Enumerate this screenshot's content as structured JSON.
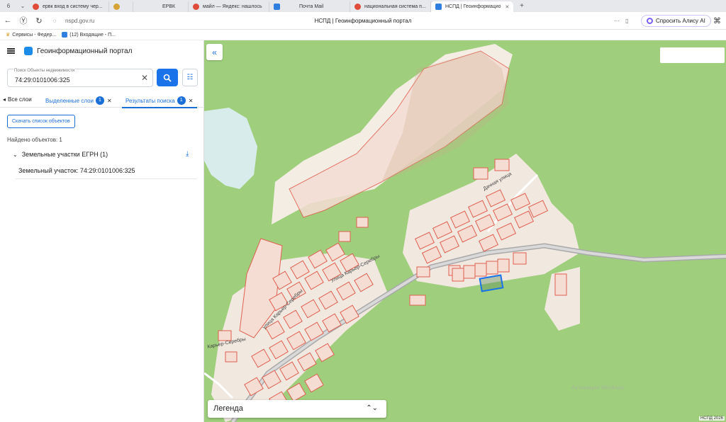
{
  "browser": {
    "tabs": [
      {
        "label": "ервк вход в систему чер...",
        "color": "#e04b3a"
      },
      {
        "label": "",
        "color": "#d6a335"
      },
      {
        "label": "ЕРВК",
        "color": ""
      },
      {
        "label": "майл — Яндекс: нашлось",
        "color": "#e04b3a"
      },
      {
        "label": "Почта Mail",
        "color": "#2f7fe0"
      },
      {
        "label": "национальная система п...",
        "color": "#e04b3a"
      },
      {
        "label": "НСПД | Геоинформацио",
        "color": "#2f7fe0",
        "active": true
      }
    ],
    "url": "nspd.gov.ru",
    "page_title": "НСПД | Геоинформационный портал",
    "alice_label": "Спросить Алису AI",
    "bookmarks": [
      "Сервисы - Федер...",
      "(12) Входящие - П..."
    ]
  },
  "app": {
    "title": "Геоинформационный портал",
    "search": {
      "label": "Поиск Объекты недвижимости",
      "value": "74:29:0101006:325"
    },
    "tabs": {
      "all_layers": "Все слои",
      "selected_layers": "Выделенные слои",
      "selected_count": "1",
      "search_results": "Результаты поиска",
      "results_count": "1"
    },
    "download_label": "Скачать список объектов",
    "found_count": "Найдено объектов: 1",
    "group_label": "Земельные участки ЕГРН (1)",
    "result_item": "Земельный участок: 74:29:0101006:325"
  },
  "map": {
    "legend_label": "Легенда",
    "copyright": "НСПД 2026",
    "watermark": "Активация Windows",
    "street_labels": [
      "Дачная улица",
      "Улица Карьер-Серебры",
      "улица Карьер-Серебры",
      "Карьер-Серебры"
    ],
    "colors": {
      "green": "#9fcf7d",
      "parcel_fill": "#f5ddd4",
      "parcel_stroke": "#e06050",
      "selected_stroke": "#1a73e8",
      "road": "#a9a9a9"
    }
  }
}
